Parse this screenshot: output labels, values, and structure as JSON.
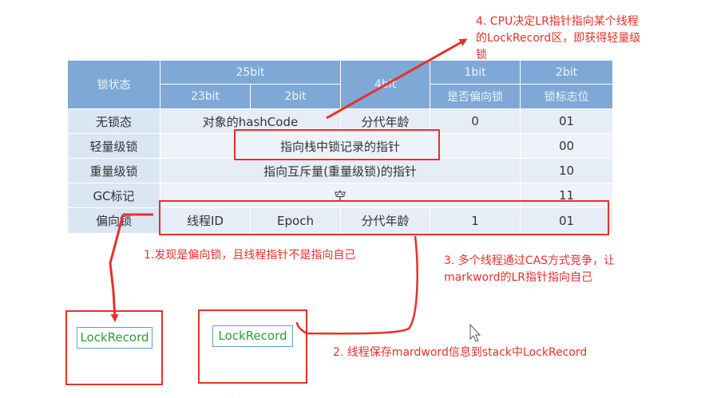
{
  "table": {
    "headers": {
      "state": "锁状态",
      "bits25": "25bit",
      "bits4": "4bit",
      "bits1": "1bit",
      "bits2": "2bit",
      "sub23": "23bit",
      "sub2": "2bit",
      "biased": "是否偏向锁",
      "flag": "锁标志位"
    },
    "rows": [
      {
        "state": "无锁态",
        "hash": "对象的hashCode",
        "age": "分代年龄",
        "biased": "0",
        "flag": "01"
      },
      {
        "state": "轻量级锁",
        "content": "指向栈中锁记录的指针",
        "flag": "00"
      },
      {
        "state": "重量级锁",
        "content": "指向互斥量(重量级锁)的指针",
        "flag": "10"
      },
      {
        "state": "GC标记",
        "content": "空",
        "flag": "11"
      },
      {
        "state": "偏向锁",
        "thread": "线程ID",
        "epoch": "Epoch",
        "age": "分代年龄",
        "biased": "1",
        "flag": "01"
      }
    ]
  },
  "annotations": {
    "note4_line1": "4. CPU决定LR指针指向某个线程",
    "note4_line2": "的LockRecord区，即获得轻量级",
    "note4_line3": "锁",
    "note1": "1.发现是偏向锁，且线程指针不是指向自己",
    "note3_line1": "3. 多个线程通过CAS方式竞争，让",
    "note3_line2": "markword的LR指针指向自己",
    "note2": "2. 线程保存mardword信息到stack中LockRecord"
  },
  "lock_records": {
    "left_label": "LockRecord",
    "right_label": "LockRecord"
  },
  "footer_text": "…",
  "colors": {
    "annotation_red": "#e8302a",
    "header_blue": "#7fa8d6",
    "row_blue": "#e6edf7",
    "lockrecord_green": "#2a9d3a"
  }
}
